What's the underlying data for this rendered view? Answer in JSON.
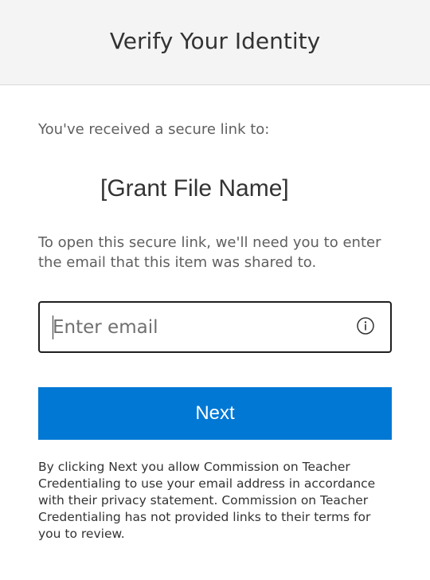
{
  "header": {
    "title": "Verify Your Identity"
  },
  "main": {
    "received_text": "You've received a secure link to:",
    "file_name": "[Grant File Name]",
    "instructions": "To open this secure link, we'll need you to enter the email that this item was shared to.",
    "email_field": {
      "value": "",
      "placeholder": "Enter email",
      "info_icon": "info-icon"
    },
    "next_button": {
      "label": "Next",
      "color": "#0078d4"
    },
    "disclaimer": "By clicking Next you allow Commission on Teacher Credentialing to use your email address in accordance with their privacy statement. Commission on Teacher Credentialing has not provided links to their terms for you to review."
  }
}
